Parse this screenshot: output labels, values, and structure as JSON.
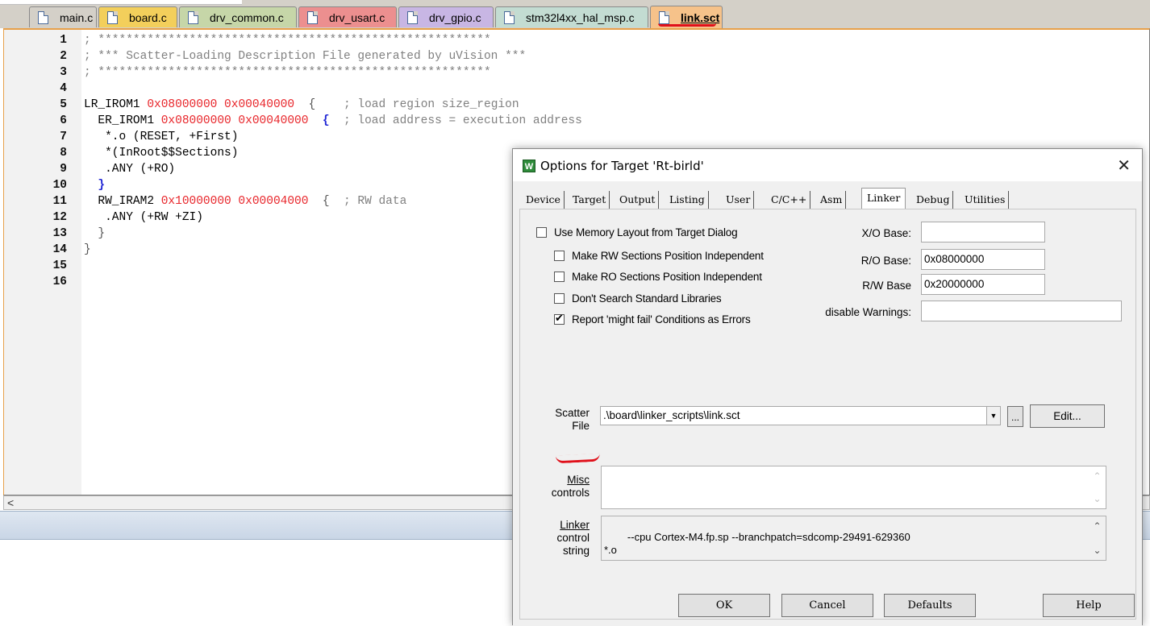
{
  "tabs": [
    {
      "label": "main.c",
      "color": "#d4d0c8"
    },
    {
      "label": "board.c",
      "color": "#f3cf5b"
    },
    {
      "label": "drv_common.c",
      "color": "#c6d6a8"
    },
    {
      "label": "drv_usart.c",
      "color": "#ec8f8f"
    },
    {
      "label": "drv_gpio.c",
      "color": "#c8b6e4"
    },
    {
      "label": "stm32l4xx_hal_msp.c",
      "color": "#c3dcd2"
    },
    {
      "label": "link.sct",
      "color": "#f6c28a"
    }
  ],
  "editor": {
    "lines": [
      {
        "n": "1",
        "parts": [
          {
            "t": "; ********************************************************",
            "c": "comment"
          }
        ]
      },
      {
        "n": "2",
        "parts": [
          {
            "t": "; *** Scatter-Loading Description File generated by uVision ***",
            "c": "comment"
          }
        ]
      },
      {
        "n": "3",
        "parts": [
          {
            "t": "; ********************************************************",
            "c": "comment"
          }
        ]
      },
      {
        "n": "4",
        "parts": []
      },
      {
        "n": "5",
        "parts": [
          {
            "t": "LR_IROM1 ",
            "c": ""
          },
          {
            "t": "0x08000000 0x00040000",
            "c": "red"
          },
          {
            "t": "  {    ",
            "c": "grey"
          },
          {
            "t": "; load region size_region",
            "c": "comment"
          }
        ]
      },
      {
        "n": "6",
        "parts": [
          {
            "t": "  ER_IROM1 ",
            "c": ""
          },
          {
            "t": "0x08000000 0x00040000",
            "c": "red"
          },
          {
            "t": "  ",
            "c": ""
          },
          {
            "t": "{",
            "c": "blue"
          },
          {
            "t": "  ",
            "c": ""
          },
          {
            "t": "; load address = execution address",
            "c": "comment"
          }
        ]
      },
      {
        "n": "7",
        "parts": [
          {
            "t": "   *.o (RESET, +First)",
            "c": ""
          }
        ]
      },
      {
        "n": "8",
        "parts": [
          {
            "t": "   *(InRoot$$Sections)",
            "c": ""
          }
        ]
      },
      {
        "n": "9",
        "parts": [
          {
            "t": "   .ANY (+RO)",
            "c": ""
          }
        ]
      },
      {
        "n": "10",
        "parts": [
          {
            "t": "  }",
            "c": "blue"
          }
        ]
      },
      {
        "n": "11",
        "parts": [
          {
            "t": "  RW_IRAM2 ",
            "c": ""
          },
          {
            "t": "0x10000000 0x00004000",
            "c": "red"
          },
          {
            "t": "  {  ",
            "c": "grey"
          },
          {
            "t": "; RW data",
            "c": "comment"
          }
        ]
      },
      {
        "n": "12",
        "parts": [
          {
            "t": "   .ANY (+RW +ZI)",
            "c": ""
          }
        ]
      },
      {
        "n": "13",
        "parts": [
          {
            "t": "  }",
            "c": "grey"
          }
        ]
      },
      {
        "n": "14",
        "parts": [
          {
            "t": "}",
            "c": "grey"
          }
        ]
      },
      {
        "n": "15",
        "parts": []
      },
      {
        "n": "16",
        "parts": []
      }
    ]
  },
  "dialog": {
    "icon": "W",
    "title": "Options for Target 'Rt-birld'",
    "close_icon": "✕",
    "tabs": [
      "Device",
      "Target",
      "Output",
      "Listing",
      "User",
      "C/C++",
      "Asm",
      "Linker",
      "Debug",
      "Utilities"
    ],
    "active_tab": "Linker",
    "checkboxes": {
      "use_memory_layout": {
        "label": "Use Memory Layout from Target Dialog",
        "checked": false
      },
      "rw_independent": {
        "label": "Make RW Sections Position Independent",
        "checked": false
      },
      "ro_independent": {
        "label": "Make RO Sections Position Independent",
        "checked": false
      },
      "dont_search": {
        "label": "Don't Search Standard Libraries",
        "checked": false
      },
      "might_fail": {
        "label": "Report 'might fail' Conditions as Errors",
        "checked": true
      }
    },
    "fields": {
      "xo_label": "X/O Base:",
      "xo_value": "",
      "ro_label": "R/O Base:",
      "ro_value": "0x08000000",
      "rw_label": "R/W Base",
      "rw_value": "0x20000000",
      "warn_label": "disable Warnings:",
      "warn_value": ""
    },
    "scatter": {
      "label_line1": "Scatter",
      "label_line2": "File",
      "value": ".\\board\\linker_scripts\\link.sct",
      "dropdown_icon": "▼",
      "browse_label": "...",
      "edit_label": "Edit..."
    },
    "misc": {
      "label_line1": "Misc",
      "label_line2": "controls",
      "value": ""
    },
    "linker": {
      "label_line1": "Linker",
      "label_line2": "control",
      "label_line3": "string",
      "value": "--cpu Cortex-M4.fp.sp --branchpatch=sdcomp-29491-629360\n*.o"
    },
    "buttons": {
      "ok": "OK",
      "cancel": "Cancel",
      "defaults": "Defaults",
      "help": "Help"
    }
  },
  "scroll_left_icon": "<",
  "annotation_color": "#e0101a"
}
